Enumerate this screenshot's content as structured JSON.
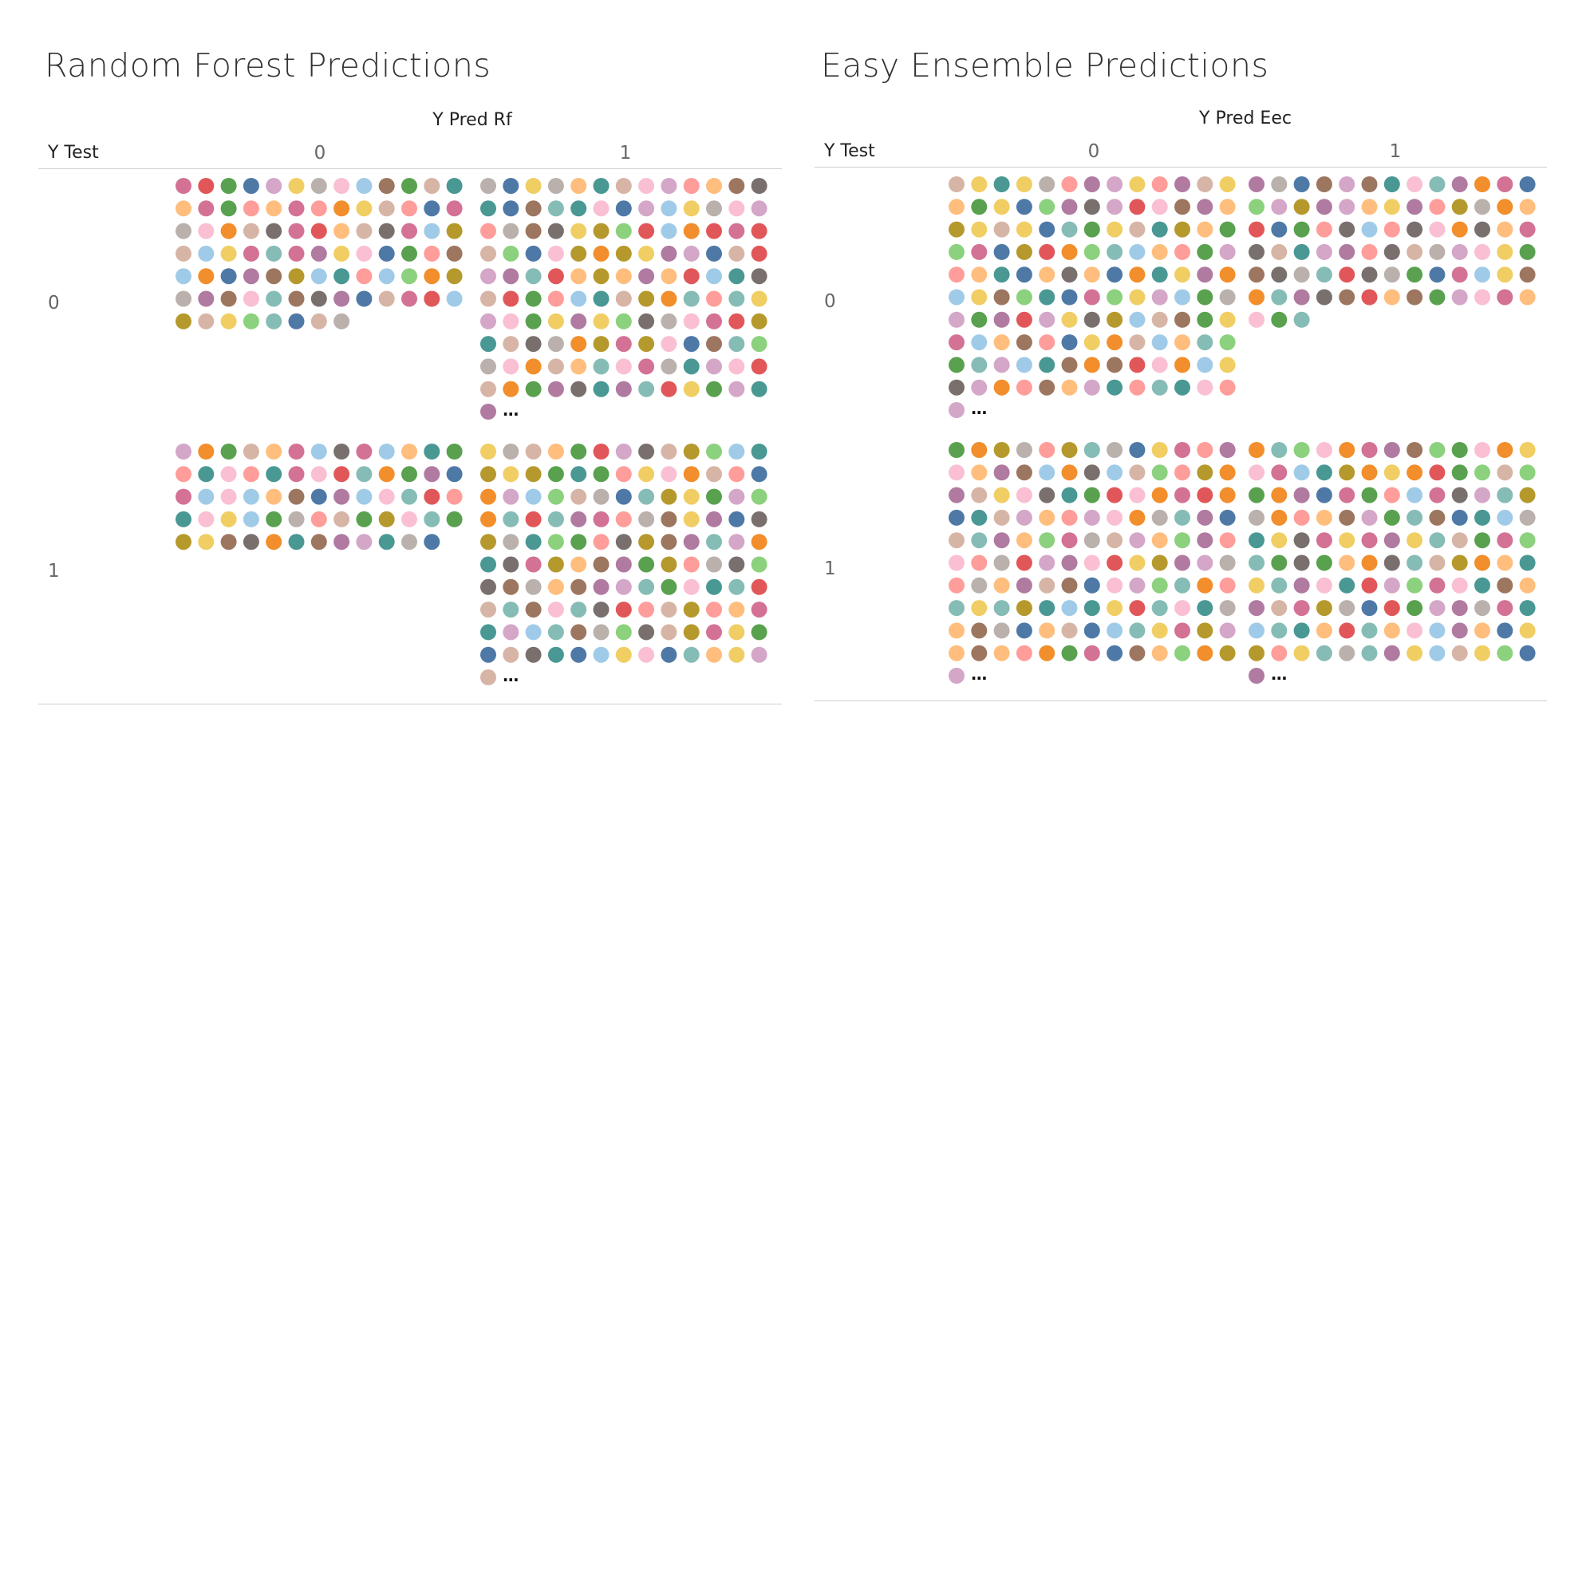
{
  "chart_data": [
    {
      "type": "scatter",
      "title": "Random Forest Predictions",
      "column_field": "Y Pred Rf",
      "row_field": "Y Test",
      "columns": [
        "0",
        "1"
      ],
      "rows": [
        "0",
        "1"
      ],
      "truncation_marker": "…",
      "cells": [
        {
          "y_test": "0",
          "y_pred": "0",
          "marks_shown": 86,
          "truncated": false
        },
        {
          "y_test": "0",
          "y_pred": "1",
          "marks_shown": 131,
          "truncated": true
        },
        {
          "y_test": "1",
          "y_pred": "0",
          "marks_shown": 64,
          "truncated": false
        },
        {
          "y_test": "1",
          "y_pred": "1",
          "marks_shown": 131,
          "truncated": true
        }
      ]
    },
    {
      "type": "scatter",
      "title": "Easy Ensemble Predictions",
      "column_field": "Y Pred Eec",
      "row_field": "Y Test",
      "columns": [
        "0",
        "1"
      ],
      "rows": [
        "0",
        "1"
      ],
      "truncation_marker": "…",
      "cells": [
        {
          "y_test": "0",
          "y_pred": "0",
          "marks_shown": 131,
          "truncated": true
        },
        {
          "y_test": "0",
          "y_pred": "1",
          "marks_shown": 81,
          "truncated": false
        },
        {
          "y_test": "1",
          "y_pred": "0",
          "marks_shown": 131,
          "truncated": true
        },
        {
          "y_test": "1",
          "y_pred": "1",
          "marks_shown": 131,
          "truncated": true
        }
      ]
    }
  ],
  "palette": [
    "#4e79a7",
    "#a0cbe8",
    "#f28e2b",
    "#ffbe7d",
    "#59a14f",
    "#8cd17d",
    "#b6992d",
    "#f1ce63",
    "#499894",
    "#86bcb6",
    "#e15759",
    "#ff9d9a",
    "#79706e",
    "#bab0ac",
    "#d37295",
    "#fabfd2",
    "#b07aa1",
    "#d4a6c8",
    "#9d7660",
    "#d7b5a6"
  ]
}
